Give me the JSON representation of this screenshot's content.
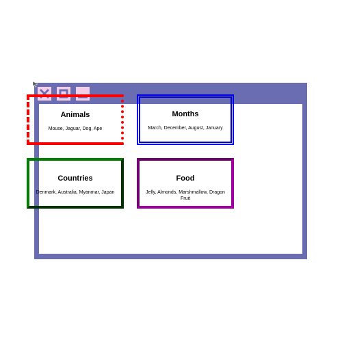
{
  "window": {
    "accent": "#6a6db2",
    "controls": {
      "close_icon": "close-icon",
      "maximize_icon": "maximize-icon",
      "minimize_icon": "minimize-icon",
      "control_color": "#f4cde6"
    }
  },
  "cards": {
    "animals": {
      "title": "Animals",
      "items": "Mouse, Jaguar, Dog, Ape",
      "color": "#ff0000"
    },
    "months": {
      "title": "Months",
      "items": "March, December, August, January",
      "color": "#0000e8"
    },
    "countries": {
      "title": "Countries",
      "items": "Denmark, Australia, Myanmar, Japan",
      "color": "#006400"
    },
    "food": {
      "title": "Food",
      "items": "Jelly, Almonds, Marshmallow, Dragon Fruit",
      "color": "#800080"
    }
  }
}
